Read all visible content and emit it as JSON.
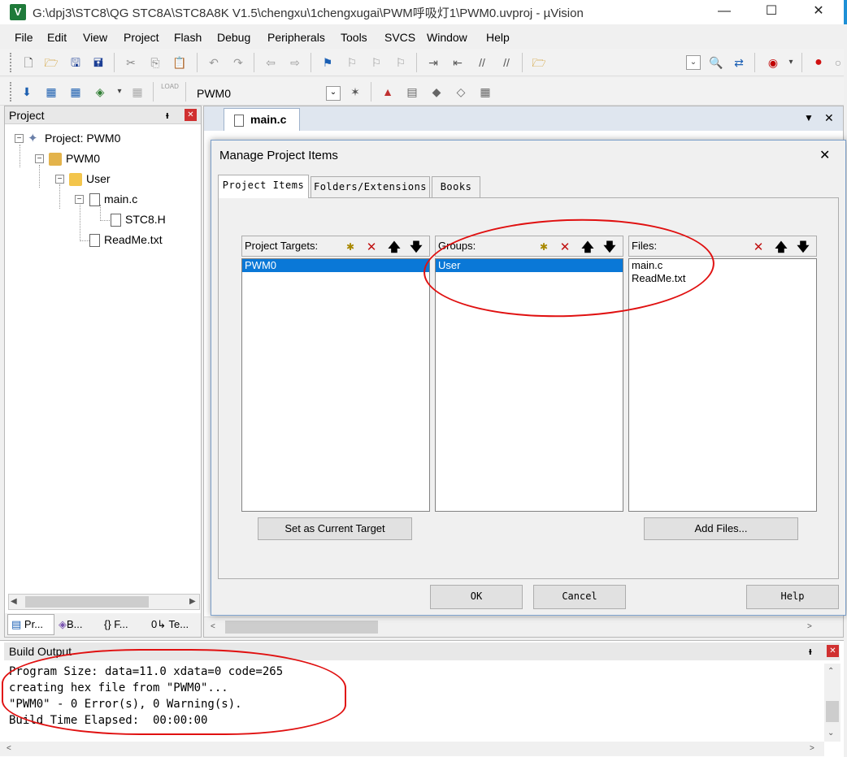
{
  "window": {
    "title": "G:\\dpj3\\STC8\\QG STC8A\\STC8A8K V1.5\\chengxu\\1chengxugai\\PWM呼吸灯1\\PWM0.uvproj - µVision",
    "app_icon": "V",
    "minimize": "—",
    "maximize": "☐",
    "close": "✕"
  },
  "menu": [
    "File",
    "Edit",
    "View",
    "Project",
    "Flash",
    "Debug",
    "Peripherals",
    "Tools",
    "SVCS",
    "Window",
    "Help"
  ],
  "toolbar2": {
    "target_value": "PWM0",
    "load_label": "LOAD"
  },
  "project_pane": {
    "title": "Project",
    "pin": "ᵻ",
    "close": "✕",
    "tree": {
      "root": "Project: PWM0",
      "target": "PWM0",
      "group": "User",
      "file1": "main.c",
      "subfile": "STC8.H",
      "file2": "ReadMe.txt"
    },
    "bottom_tabs": [
      "Pr...",
      "B...",
      "{} F...",
      "0↳ Te..."
    ]
  },
  "editor": {
    "tab_label": "main.c",
    "dropdown": "▼",
    "close": "✕"
  },
  "dialog": {
    "title": "Manage Project Items",
    "close": "✕",
    "tabs": [
      "Project Items",
      "Folders/Extensions",
      "Books"
    ],
    "targets": {
      "header": "Project Targets:",
      "items": [
        "PWM0"
      ],
      "selected": 0
    },
    "groups": {
      "header": "Groups:",
      "items": [
        "User"
      ],
      "selected": 0
    },
    "files": {
      "header": "Files:",
      "items": [
        "main.c",
        "ReadMe.txt"
      ]
    },
    "set_target_button": "Set as Current Target",
    "add_files_button": "Add Files...",
    "ok_button": "OK",
    "cancel_button": "Cancel",
    "help_button": "Help",
    "header_icons": {
      "new": "✱",
      "delete": "✕",
      "up": "🡅",
      "down": "🡇"
    }
  },
  "build_output": {
    "title": "Build Output",
    "lines": [
      "Program Size: data=11.0 xdata=0 code=265",
      "creating hex file from \"PWM0\"...",
      "\"PWM0\" - 0 Error(s), 0 Warning(s).",
      "Build Time Elapsed:  00:00:00"
    ]
  },
  "colors": {
    "selection": "#0a78d7",
    "annotation": "#e01010",
    "accent": "#1e90d6"
  }
}
